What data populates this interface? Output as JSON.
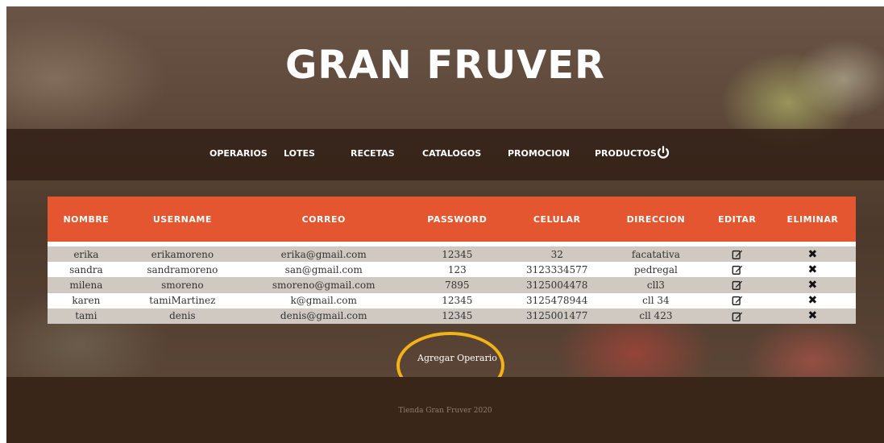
{
  "header": {
    "title": "GRAN FRUVER"
  },
  "nav": {
    "items": [
      "OPERARIOS",
      "LOTES",
      "RECETAS",
      "CATALOGOS",
      "PROMOCION",
      "PRODUCTOS"
    ],
    "power_icon": "power-icon"
  },
  "table": {
    "columns": [
      "NOMBRE",
      "USERNAME",
      "CORREO",
      "PASSWORD",
      "CELULAR",
      "DIRECCION",
      "EDITAR",
      "ELIMINAR"
    ],
    "rows": [
      [
        "erika",
        "erikamoreno",
        "erika@gmail.com",
        "12345",
        "32",
        "facatativa"
      ],
      [
        "sandra",
        "sandramoreno",
        "san@gmail.com",
        "123",
        "3123334577",
        "pedregal"
      ],
      [
        "milena",
        "smoreno",
        "smoreno@gmail.com",
        "7895",
        "3125004478",
        "cll3"
      ],
      [
        "karen",
        "tamiMartinez",
        "k@gmail.com",
        "12345",
        "3125478944",
        "cll 34"
      ],
      [
        "tami",
        "denis",
        "denis@gmail.com",
        "12345",
        "3125001477",
        "cll 423"
      ]
    ],
    "edit_icon": "edit-icon",
    "delete_icon": "close-icon"
  },
  "actions": {
    "add_label": "Agregar Operario"
  },
  "footer": {
    "text": "Tienda Gran Fruver 2020"
  },
  "colors": {
    "header_row": "#e4562f",
    "highlight_ring": "#f1b317",
    "stripe": "#d0c9c2"
  }
}
